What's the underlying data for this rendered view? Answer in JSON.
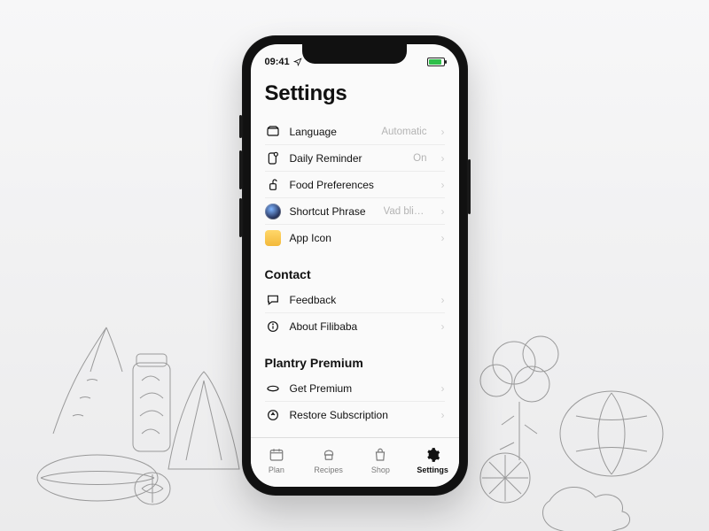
{
  "status": {
    "time": "09:41"
  },
  "page": {
    "title": "Settings"
  },
  "sections": {
    "main": {
      "items": [
        {
          "label": "Language",
          "value": "Automatic"
        },
        {
          "label": "Daily Reminder",
          "value": "On"
        },
        {
          "label": "Food Preferences",
          "value": ""
        },
        {
          "label": "Shortcut Phrase",
          "value": "Vad blir det…"
        },
        {
          "label": "App Icon",
          "value": ""
        }
      ]
    },
    "contact": {
      "title": "Contact",
      "items": [
        {
          "label": "Feedback"
        },
        {
          "label": "About Filibaba"
        }
      ]
    },
    "premium": {
      "title": "Plantry Premium",
      "items": [
        {
          "label": "Get Premium"
        },
        {
          "label": "Restore Subscription"
        }
      ]
    }
  },
  "tabs": [
    {
      "label": "Plan"
    },
    {
      "label": "Recipes"
    },
    {
      "label": "Shop"
    },
    {
      "label": "Settings"
    }
  ]
}
